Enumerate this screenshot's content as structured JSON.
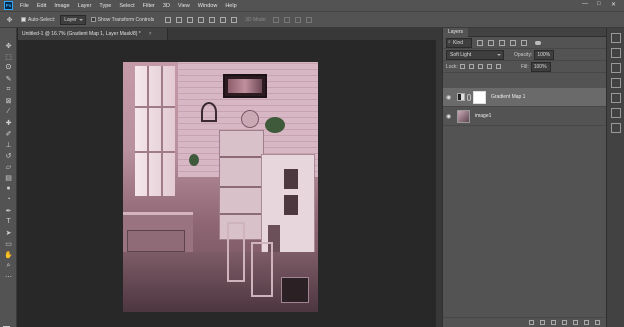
{
  "menubar": {
    "app_logo": "Ps",
    "items": [
      "File",
      "Edit",
      "Image",
      "Layer",
      "Type",
      "Select",
      "Filter",
      "3D",
      "View",
      "Window",
      "Help"
    ],
    "window_controls": [
      "—",
      "□",
      "✕"
    ]
  },
  "options": {
    "auto_select_label": "Auto-Select:",
    "auto_select_value": "Layer",
    "show_transform_label": "Show Transform Controls",
    "mode_3d_label": "3D Mode:"
  },
  "document": {
    "tab_title": "Untitled-1 @ 16.7% (Gradient Map 1, Layer Mask/8) *",
    "close": "×"
  },
  "layers_panel": {
    "tab_label": "Layers",
    "kind_label": "Kind",
    "blend_mode": "Soft Light",
    "opacity_label": "Opacity:",
    "opacity_value": "100%",
    "lock_label": "Lock:",
    "fill_label": "Fill:",
    "fill_value": "100%",
    "layers": [
      {
        "name": "Gradient Map 1",
        "visible": true,
        "selected": true
      },
      {
        "name": "image1",
        "visible": true,
        "selected": false
      }
    ]
  },
  "colors": {
    "foreground": "#000000",
    "background": "#ffffff",
    "accent": "#31a8ff"
  }
}
